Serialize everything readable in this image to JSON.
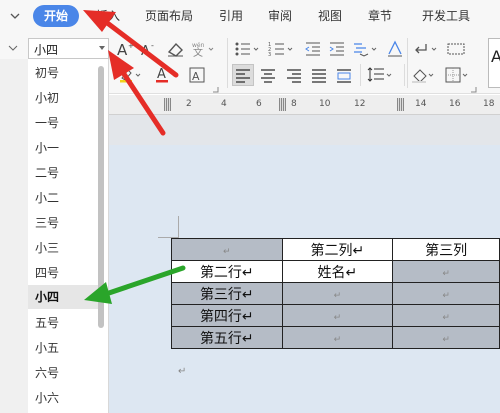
{
  "menubar": {
    "items": [
      "开始",
      "插入",
      "页面布局",
      "引用",
      "审阅",
      "视图",
      "章节",
      "开发工具"
    ]
  },
  "toolbar": {
    "font_size_value": "小四"
  },
  "font_size_dropdown": {
    "items": [
      "初号",
      "小初",
      "一号",
      "小一",
      "二号",
      "小二",
      "三号",
      "小三",
      "四号",
      "小四",
      "五号",
      "小五",
      "六号",
      "小六"
    ],
    "selected": "小四"
  },
  "ruler": {
    "labels": [
      "2",
      "4",
      "6",
      "8",
      "10",
      "12",
      "14",
      "16",
      "18"
    ]
  },
  "table": {
    "headers": [
      "↵",
      "第二列↵",
      "第三列"
    ],
    "rows": [
      [
        "第二行↵",
        "姓名↵",
        "↵"
      ],
      [
        "第三行↵",
        "↵",
        "↵"
      ],
      [
        "第四行↵",
        "↵",
        "↵"
      ],
      [
        "第五行↵",
        "↵",
        "↵"
      ]
    ]
  },
  "para_mark": "↵",
  "colors": {
    "accent": "#4a86e8",
    "arrow_red": "#e52d27",
    "arrow_green": "#2aa52a",
    "table_shade": "#b5bcc6",
    "doc_bg": "#dde7f2"
  }
}
